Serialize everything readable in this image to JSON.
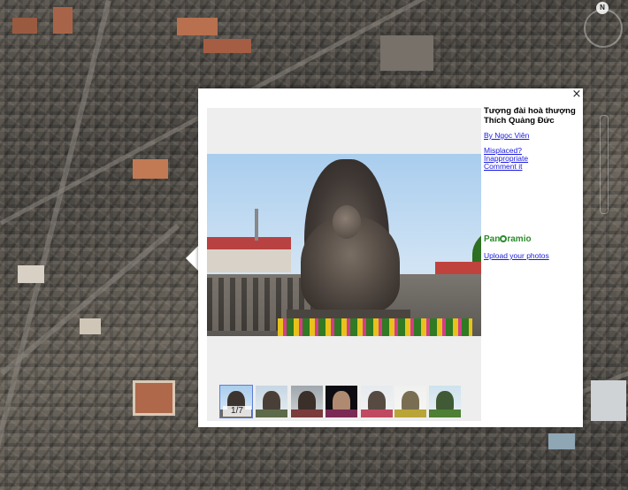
{
  "balloon": {
    "title": "Tượng đài hoà thượng Thích Quảng Đức",
    "author": "By Ngọc Viên",
    "links": {
      "misplaced": "Misplaced?",
      "inappropriate": "Inappropriate",
      "comment": "Comment it"
    },
    "logo": {
      "before": "Pan",
      "after": "ramio"
    },
    "upload": "Upload your photos",
    "close_glyph": "×",
    "thumbnails": {
      "counter": "1/7",
      "count": 7,
      "selected_index": 0
    }
  },
  "nav": {
    "compass_label": "N"
  },
  "icons": [
    "close-icon",
    "compass-icon",
    "panoramio-logo-icon"
  ],
  "colors": {
    "link": "#1a1ae0",
    "logo_green": "#2e8b2e",
    "selection": "#5a7fd6"
  }
}
